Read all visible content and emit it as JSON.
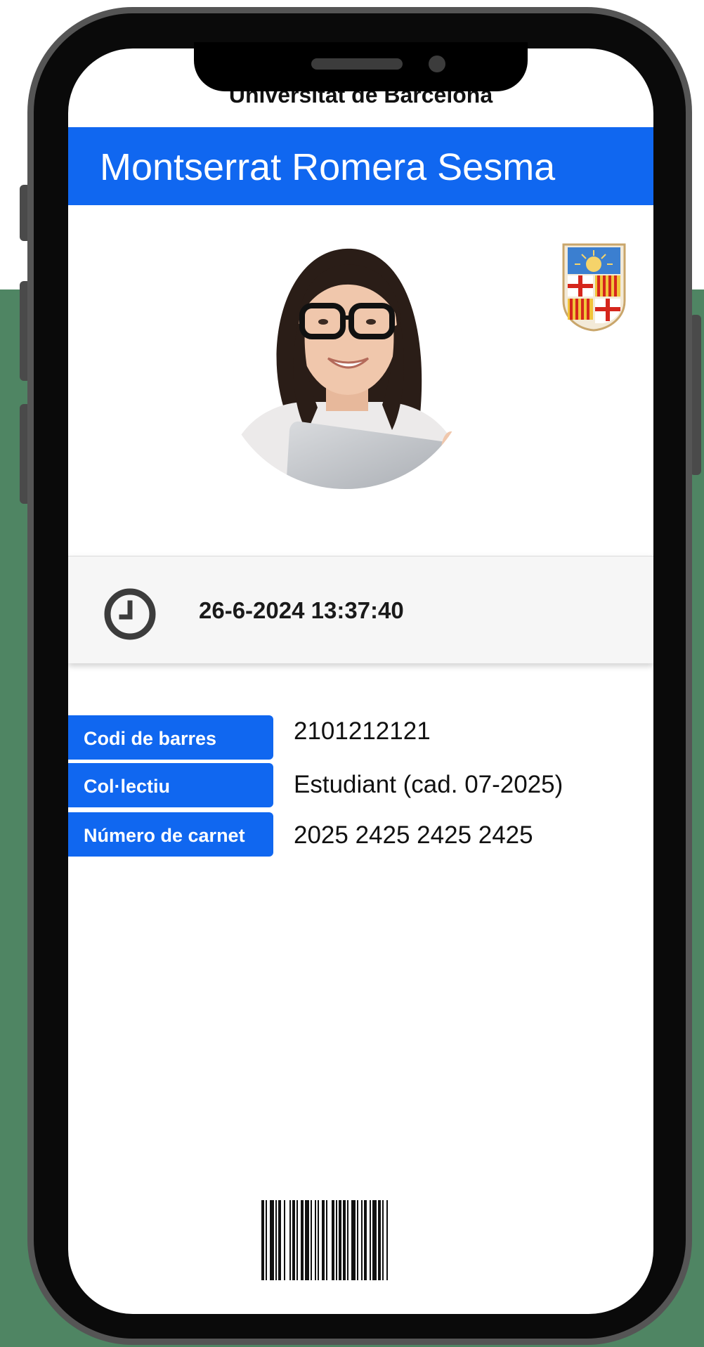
{
  "header": {
    "university": "Universitat de Barcelona",
    "holder_name": "Montserrat Romera Sesma"
  },
  "status": {
    "timestamp": "26-6-2024 13:37:40",
    "icon": "clock-icon"
  },
  "fields": [
    {
      "label": "Codi de barres",
      "value": "2101212121"
    },
    {
      "label": "Col·lectiu",
      "value": "Estudiant (cad. 07-2025)"
    },
    {
      "label": "Número de carnet",
      "value": "2025 2425 2425 2425"
    }
  ],
  "colors": {
    "accent": "#1067f0",
    "background_green": "#4f8563",
    "phone_frame": "#555555"
  }
}
